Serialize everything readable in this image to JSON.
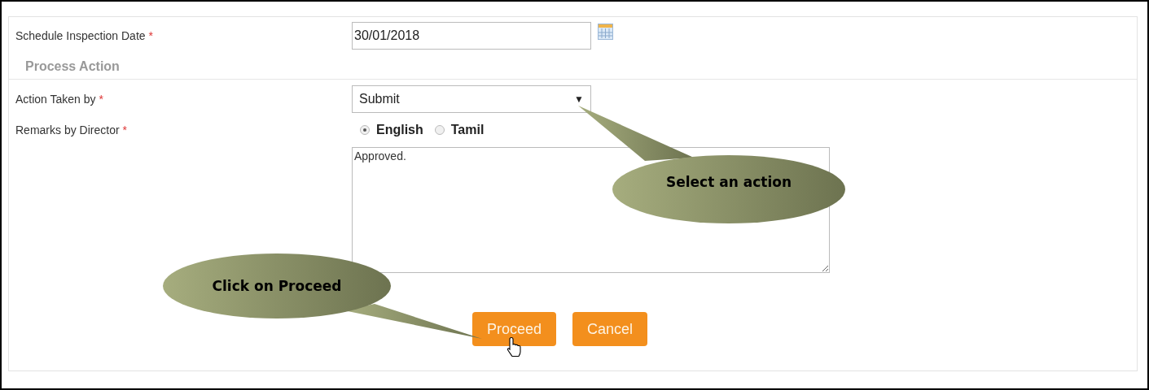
{
  "form": {
    "date_field": {
      "label": "Schedule Inspection Date",
      "required_mark": "*",
      "value": "30/01/2018"
    },
    "section_title": "Process Action",
    "action_field": {
      "label": "Action Taken by",
      "required_mark": "*",
      "value": "Submit",
      "arrow": "▼"
    },
    "remarks_field": {
      "label": "Remarks by Director",
      "required_mark": "*",
      "languages": [
        {
          "label": "English",
          "selected": true
        },
        {
          "label": "Tamil",
          "selected": false
        }
      ],
      "value": "Approved."
    },
    "buttons": [
      {
        "label": "Proceed",
        "hovered": true
      },
      {
        "label": "Cancel",
        "hovered": false
      }
    ]
  },
  "callouts": [
    {
      "text": "Select an action"
    },
    {
      "text": "Click on Proceed"
    }
  ]
}
